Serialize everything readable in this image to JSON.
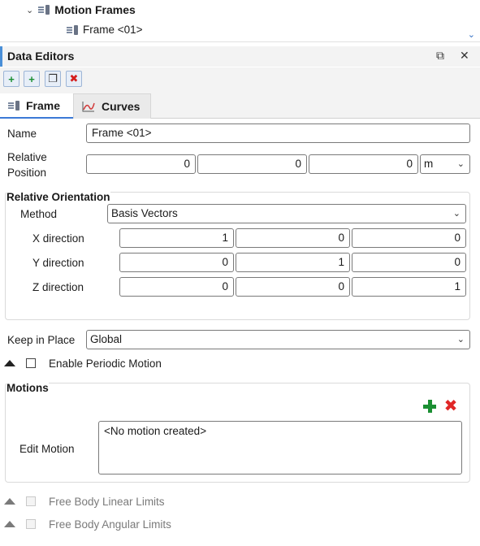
{
  "tree": {
    "parent_label": "Motion Frames",
    "child_label": "Frame <01>"
  },
  "panel": {
    "title": "Data Editors",
    "restore_glyph": "⧉",
    "close_glyph": "✕"
  },
  "toolbar": {
    "buttons": [
      {
        "icon": "add-frame-icon",
        "glyph": "+"
      },
      {
        "icon": "add-child-frame-icon",
        "glyph": "+"
      },
      {
        "icon": "copy-icon",
        "glyph": "❐"
      },
      {
        "icon": "delete-icon",
        "glyph": "✖"
      }
    ]
  },
  "tabs": [
    {
      "label": "Frame",
      "active": true
    },
    {
      "label": "Curves",
      "active": false
    }
  ],
  "form": {
    "name_label": "Name",
    "name_value": "Frame <01>",
    "relpos_label_1": "Relative",
    "relpos_label_2": "Position",
    "relpos_values": [
      "0",
      "0",
      "0"
    ],
    "relpos_unit": "m",
    "orientation": {
      "title": "Relative Orientation",
      "method_label": "Method",
      "method_value": "Basis Vectors",
      "rows": [
        {
          "label": "X direction",
          "values": [
            "1",
            "0",
            "0"
          ]
        },
        {
          "label": "Y direction",
          "values": [
            "0",
            "1",
            "0"
          ]
        },
        {
          "label": "Z direction",
          "values": [
            "0",
            "0",
            "1"
          ]
        }
      ]
    },
    "keep_in_place_label": "Keep in Place",
    "keep_in_place_value": "Global",
    "periodic_label": "Enable Periodic Motion",
    "motions": {
      "title": "Motions",
      "edit_label": "Edit Motion",
      "list_text": "<No motion created>"
    },
    "linear_limits_label": "Free Body Linear Limits",
    "angular_limits_label": "Free Body Angular Limits"
  },
  "colors": {
    "accent": "#3c7ad6",
    "add": "#1b8f33",
    "delete": "#e02727"
  }
}
